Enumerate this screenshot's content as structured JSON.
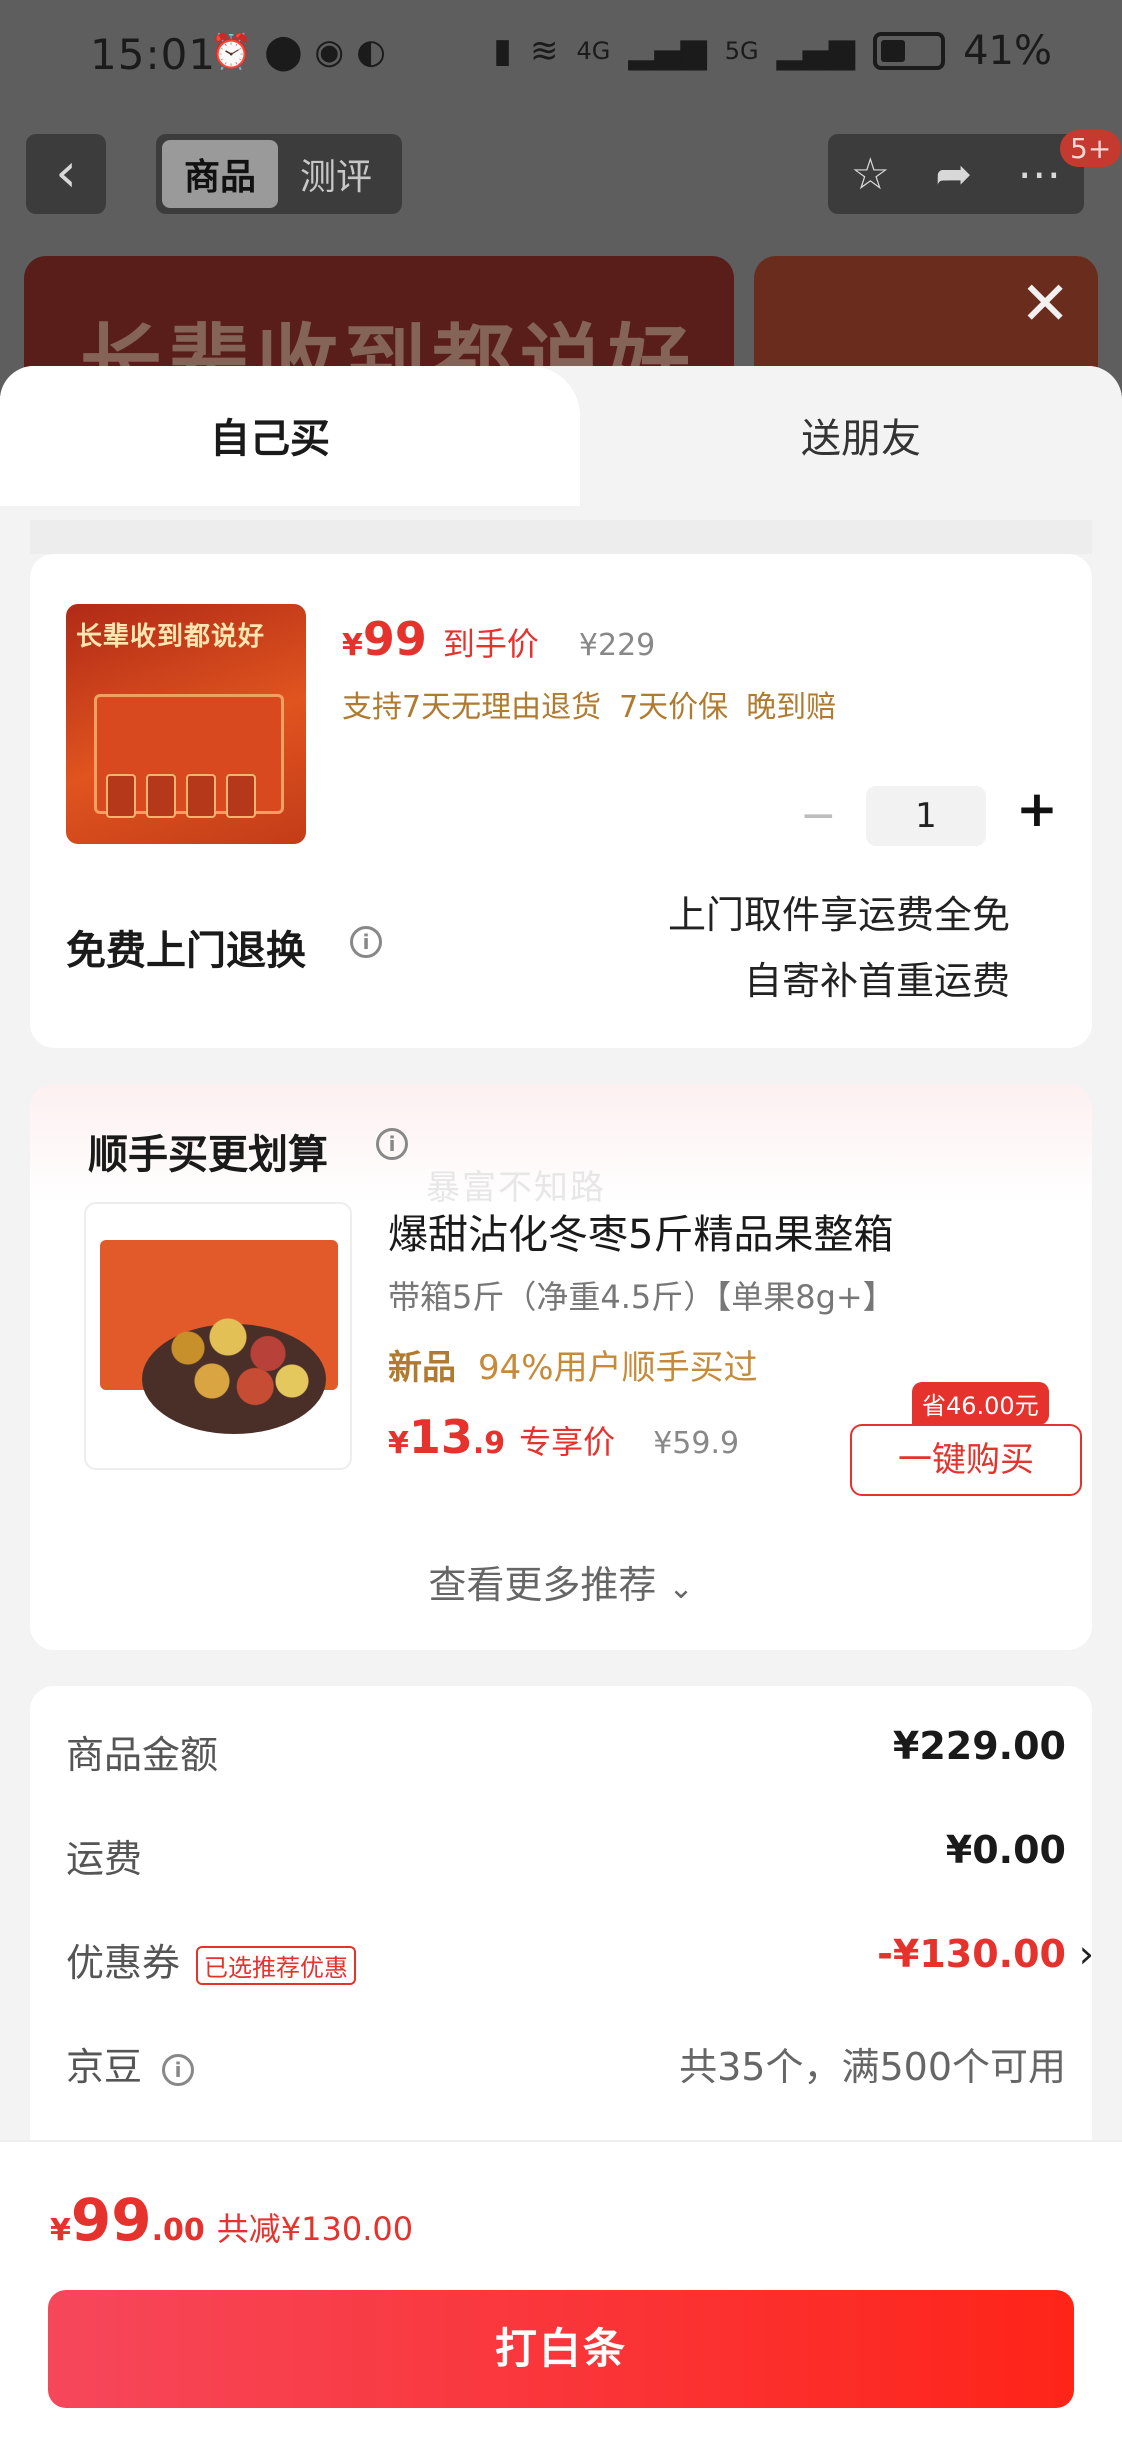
{
  "status_bar": {
    "time": "15:01",
    "left_icons": [
      "alarm-icon",
      "location-icon",
      "zhi-app-icon",
      "wechat-icon"
    ],
    "network_4g": "4G",
    "network_5g": "5G",
    "battery_percent": "41%"
  },
  "nav": {
    "tabs": [
      {
        "label": "商品",
        "active": true
      },
      {
        "label": "测评",
        "active": false
      }
    ],
    "badge": "5+"
  },
  "banner": {
    "text": "长辈收到都说好"
  },
  "sheet": {
    "tabs": [
      {
        "label": "自己买",
        "active": true
      },
      {
        "label": "送朋友",
        "active": false
      }
    ],
    "product": {
      "image_text": "长辈收到都说好",
      "price_symbol": "¥",
      "price": "99",
      "price_label": "到手价",
      "original_price": "¥229",
      "services": [
        "支持7天无理由退货",
        "7天价保",
        "晚到赔"
      ],
      "quantity": "1"
    },
    "returns": {
      "label": "免费上门退换",
      "line1": "上门取件享运费全免",
      "line2": "自寄补首重运费"
    },
    "recommend": {
      "title": "顺手买更划算",
      "watermark": "暴富不知路",
      "item": {
        "name": "爆甜沾化冬枣5斤精品果整箱",
        "spec": "带箱5斤（净重4.5斤）【单果8g+】",
        "tag_new": "新品",
        "tag_bought": "94%用户顺手买过",
        "price_symbol": "¥",
        "price_int": "13",
        "price_dec": ".9",
        "price_label": "专享价",
        "original_price": "¥59.9",
        "save_badge": "省46.00元",
        "buy_label": "一键购买"
      },
      "more_label": "查看更多推荐"
    },
    "summary": {
      "goods_amount": {
        "label": "商品金额",
        "value": "¥229.00"
      },
      "shipping": {
        "label": "运费",
        "value": "¥0.00"
      },
      "coupon": {
        "label": "优惠券",
        "tag": "已选推荐优惠",
        "value": "-¥130.00"
      },
      "beans": {
        "label": "京豆",
        "value": "共35个，满500个可用"
      }
    }
  },
  "bottom": {
    "price_symbol": "¥",
    "price_int": "99",
    "price_dec": ".00",
    "total_saving": "共减¥130.00",
    "pay_label": "打白条"
  },
  "colors": {
    "accent": "#e5322d",
    "button_gradient_start": "#f6475b",
    "button_gradient_end": "#fe2418",
    "gold_text": "#b07a2f"
  }
}
